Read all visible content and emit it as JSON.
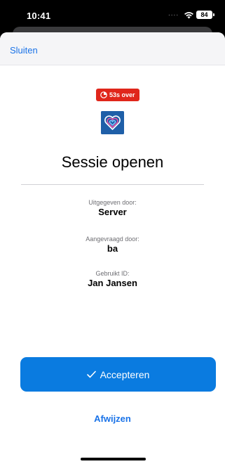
{
  "status_bar": {
    "time": "10:41",
    "signal": "....",
    "battery": "84"
  },
  "nav": {
    "close_label": "Sluiten"
  },
  "timer": {
    "label": "53s over"
  },
  "title": "Sessie openen",
  "issued_by": {
    "label": "Uitgegeven door:",
    "value": "Server"
  },
  "requested_by": {
    "label": "Aangevraagd door:",
    "value": "ba"
  },
  "used_id": {
    "label": "Gebruikt ID:",
    "value": "Jan Jansen"
  },
  "accept_label": "Accepteren",
  "reject_label": "Afwijzen",
  "colors": {
    "accent": "#0a7be0",
    "badge": "#e0261b",
    "logo": "#1f5fa8"
  },
  "icons": {
    "wifi": "wifi-icon",
    "battery": "battery-icon",
    "timer": "timer-icon",
    "logo": "heart-logo-icon",
    "check": "check-icon"
  }
}
